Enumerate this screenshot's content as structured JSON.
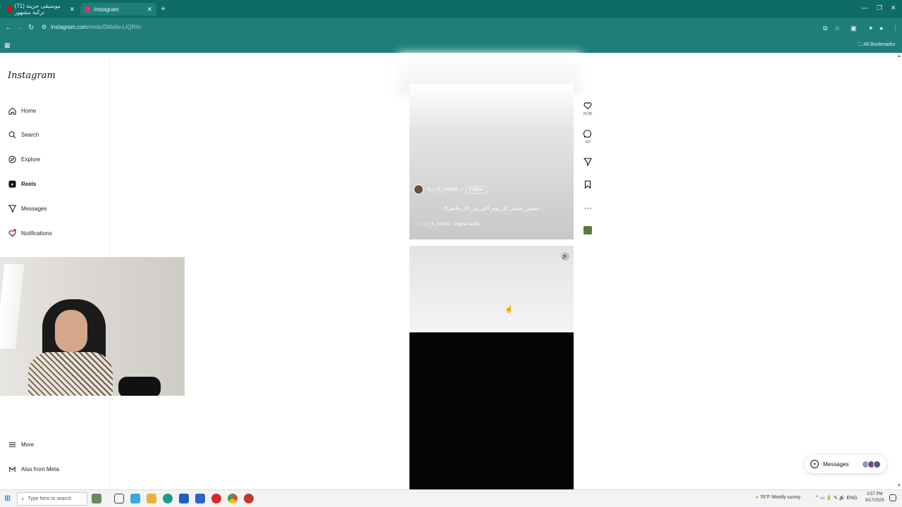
{
  "browser": {
    "tabs": [
      {
        "label": "(71) موسيقى حزينة تركية مشهور",
        "favicon_color": "#ff0000"
      },
      {
        "label": "Instagram",
        "favicon_color": "#e1306c"
      }
    ],
    "url_host": "instagram.com",
    "url_path": "/reels/DMafw-LIQRA/",
    "all_bookmarks_label": "All Bookmarks",
    "accent": "#1e7f79"
  },
  "sidebar": {
    "logo": "Instagram",
    "items": [
      {
        "label": "Home",
        "icon": "home-icon"
      },
      {
        "label": "Search",
        "icon": "search-icon"
      },
      {
        "label": "Explore",
        "icon": "compass-icon"
      },
      {
        "label": "Reels",
        "icon": "reels-icon"
      },
      {
        "label": "Messages",
        "icon": "send-icon"
      },
      {
        "label": "Notifications",
        "icon": "heart-icon"
      }
    ],
    "more_label": "More",
    "meta_label": "Also from Meta"
  },
  "reel": {
    "username": "b_r_h_m2006",
    "follow_label": "Follow",
    "caption": "#تبعوني_تحصل_كل_يوم_اكثر_من_10_متابعين",
    "audio": "b_r_h_m2006 · Original audio",
    "likes": "22.6K",
    "comments": "110"
  },
  "messages_pill": {
    "label": "Messages"
  },
  "taskbar": {
    "search_placeholder": "Type here to search",
    "weather": "76°F Mostly sunny",
    "lang": "ENG",
    "time": "3:57 PM",
    "date": "9/17/2025"
  }
}
